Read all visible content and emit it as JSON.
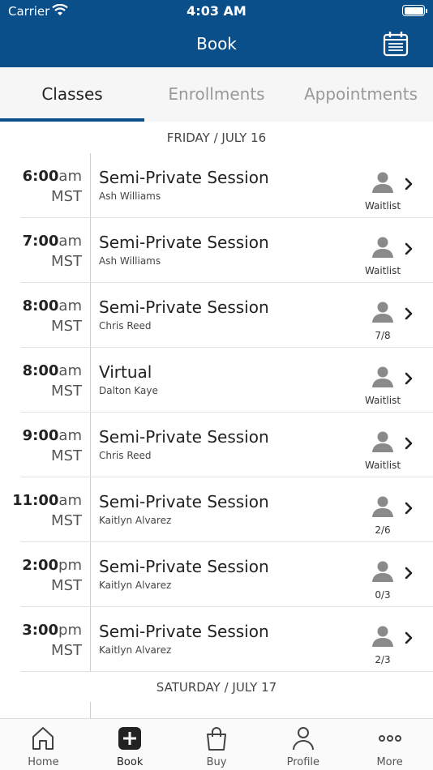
{
  "status": {
    "carrier": "Carrier",
    "time": "4:03 AM"
  },
  "header": {
    "title": "Book"
  },
  "tabs": [
    {
      "label": "Classes",
      "active": true
    },
    {
      "label": "Enrollments",
      "active": false
    },
    {
      "label": "Appointments",
      "active": false
    }
  ],
  "days": [
    {
      "date": "FRIDAY / JULY 16",
      "rows": [
        {
          "hour": "6:00",
          "ampm": "am",
          "tz": "MST",
          "name": "Semi-Private Session",
          "instructor": "Ash Williams",
          "cap": "Waitlist"
        },
        {
          "hour": "7:00",
          "ampm": "am",
          "tz": "MST",
          "name": "Semi-Private Session",
          "instructor": "Ash Williams",
          "cap": "Waitlist"
        },
        {
          "hour": "8:00",
          "ampm": "am",
          "tz": "MST",
          "name": "Semi-Private Session",
          "instructor": "Chris Reed",
          "cap": "7/8"
        },
        {
          "hour": "8:00",
          "ampm": "am",
          "tz": "MST",
          "name": "Virtual",
          "instructor": "Dalton Kaye",
          "cap": "Waitlist"
        },
        {
          "hour": "9:00",
          "ampm": "am",
          "tz": "MST",
          "name": "Semi-Private Session",
          "instructor": "Chris Reed",
          "cap": "Waitlist"
        },
        {
          "hour": "11:00",
          "ampm": "am",
          "tz": "MST",
          "name": "Semi-Private Session",
          "instructor": "Kaitlyn Alvarez",
          "cap": "2/6"
        },
        {
          "hour": "2:00",
          "ampm": "pm",
          "tz": "MST",
          "name": "Semi-Private Session",
          "instructor": "Kaitlyn Alvarez",
          "cap": "0/3"
        },
        {
          "hour": "3:00",
          "ampm": "pm",
          "tz": "MST",
          "name": "Semi-Private Session",
          "instructor": "Kaitlyn Alvarez",
          "cap": "2/3"
        }
      ]
    },
    {
      "date": "SATURDAY / JULY 17",
      "rows": []
    }
  ],
  "tabbar": [
    {
      "label": "Home",
      "icon": "home-icon"
    },
    {
      "label": "Book",
      "icon": "plus-square-icon",
      "active": true
    },
    {
      "label": "Buy",
      "icon": "shopping-bag-icon"
    },
    {
      "label": "Profile",
      "icon": "person-icon"
    },
    {
      "label": "More",
      "icon": "more-dots-icon"
    }
  ],
  "colors": {
    "brand": "#0b4f8a",
    "icon_gray": "#8a8a8a"
  }
}
